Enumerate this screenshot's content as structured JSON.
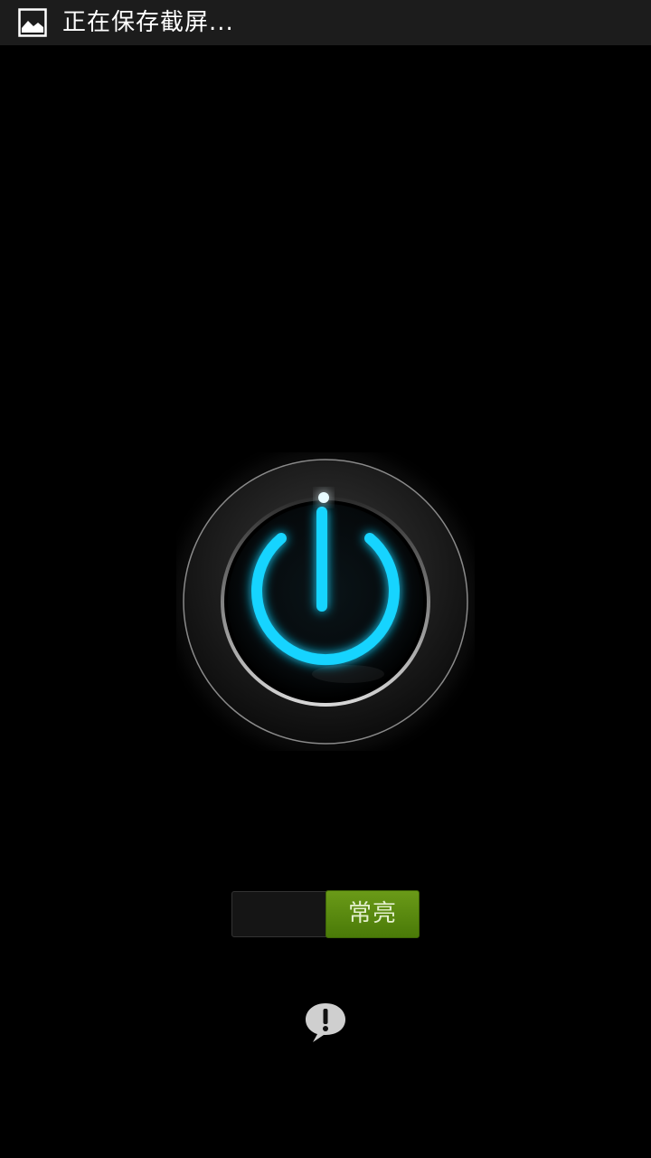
{
  "status_bar": {
    "icon": "image-icon",
    "text": "正在保存截屏..."
  },
  "power_button": {
    "icon": "power-icon",
    "glow_color": "#19d4ff"
  },
  "toggle": {
    "label": "常亮",
    "state": "on",
    "accent_color": "#5a8a10"
  },
  "help": {
    "icon": "exclamation-bubble-icon"
  }
}
